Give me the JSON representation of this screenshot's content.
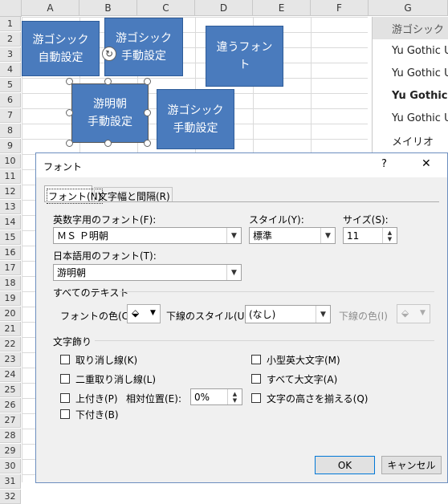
{
  "sheet": {
    "columns": [
      "A",
      "B",
      "C",
      "D",
      "E",
      "F",
      "G"
    ],
    "rows": [
      "1",
      "2",
      "3",
      "4",
      "5",
      "6",
      "7",
      "8",
      "9",
      "10",
      "11",
      "12",
      "13",
      "14",
      "15",
      "16",
      "17",
      "18",
      "19",
      "20",
      "21",
      "22",
      "23",
      "24",
      "25",
      "26",
      "27",
      "28",
      "29",
      "30",
      "31",
      "32"
    ]
  },
  "shapes": {
    "s1": "游ゴシック\n自動設定",
    "s2": "游ゴシック\n手動設定",
    "s3": "違うフォン\nト",
    "s4": "游明朝\n手動設定",
    "s5": "游ゴシック\n手動設定"
  },
  "fontlist": [
    "游ゴシック",
    "Yu Gothic U",
    "Yu Gothic U",
    "Yu Gothic",
    "Yu Gothic U",
    "メイリオ"
  ],
  "dialog": {
    "title": "フォント",
    "help": "?",
    "close": "✕",
    "tabs": [
      "フォント(N)",
      "文字幅と間隔(R)"
    ],
    "latin_font_label": "英数字用のフォント(F):",
    "latin_font_value": "ＭＳ Ｐ明朝",
    "style_label": "スタイル(Y):",
    "style_value": "標準",
    "size_label": "サイズ(S):",
    "size_value": "11",
    "asian_font_label": "日本語用のフォント(T):",
    "asian_font_value": "游明朝",
    "all_text_header": "すべてのテキスト",
    "font_color_label": "フォントの色(C)",
    "underline_style_label": "下線のスタイル(U)",
    "underline_style_value": "(なし)",
    "underline_color_label": "下線の色(I)",
    "effects_header": "文字飾り",
    "strike": "取り消し線(K)",
    "double_strike": "二重取り消し線(L)",
    "superscript": "上付き(P)",
    "offset_label": "相対位置(E):",
    "offset_value": "0%",
    "subscript": "下付き(B)",
    "small_caps": "小型英大文字(M)",
    "all_caps": "すべて大文字(A)",
    "equalize_height": "文字の高さを揃える(Q)",
    "ok": "OK",
    "cancel": "キャンセル"
  },
  "colors": {
    "shape_fill": "#4a7bbd",
    "dialog_bg": "#f0f0f0"
  }
}
